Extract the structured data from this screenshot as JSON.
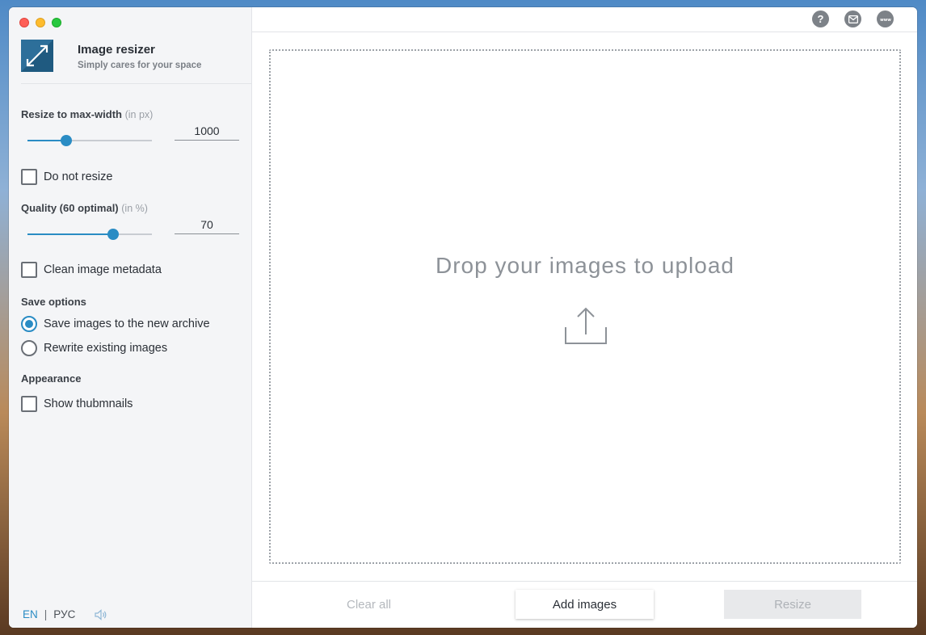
{
  "app": {
    "title": "Image resizer",
    "subtitle": "Simply cares for your space"
  },
  "resize": {
    "label": "Resize to max-width",
    "hint": "(in px)",
    "value": "1000",
    "slider_fraction": 0.31
  },
  "no_resize": {
    "label": "Do not resize",
    "checked": false
  },
  "quality": {
    "label": "Quality (60 optimal)",
    "hint": "(in %)",
    "value": "70",
    "slider_fraction": 0.69
  },
  "clean_metadata": {
    "label": "Clean image metadata",
    "checked": false
  },
  "save_options": {
    "heading": "Save options",
    "options": [
      {
        "label": "Save images to the new archive",
        "selected": true
      },
      {
        "label": "Rewrite existing images",
        "selected": false
      }
    ]
  },
  "appearance": {
    "heading": "Appearance",
    "show_thumbnails": {
      "label": "Show thubmnails",
      "checked": false
    }
  },
  "language": {
    "en": "EN",
    "separator": "|",
    "ru": "РУС"
  },
  "topbar": {
    "help_glyph": "?",
    "icons": [
      "help-icon",
      "mail-icon",
      "www-icon"
    ]
  },
  "drop_zone": {
    "text": "Drop your images to upload"
  },
  "footer": {
    "clear_label": "Clear all",
    "add_label": "Add images",
    "resize_label": "Resize"
  },
  "colors": {
    "accent": "#2a8cc4",
    "disabled_text": "#aeb2b7"
  }
}
